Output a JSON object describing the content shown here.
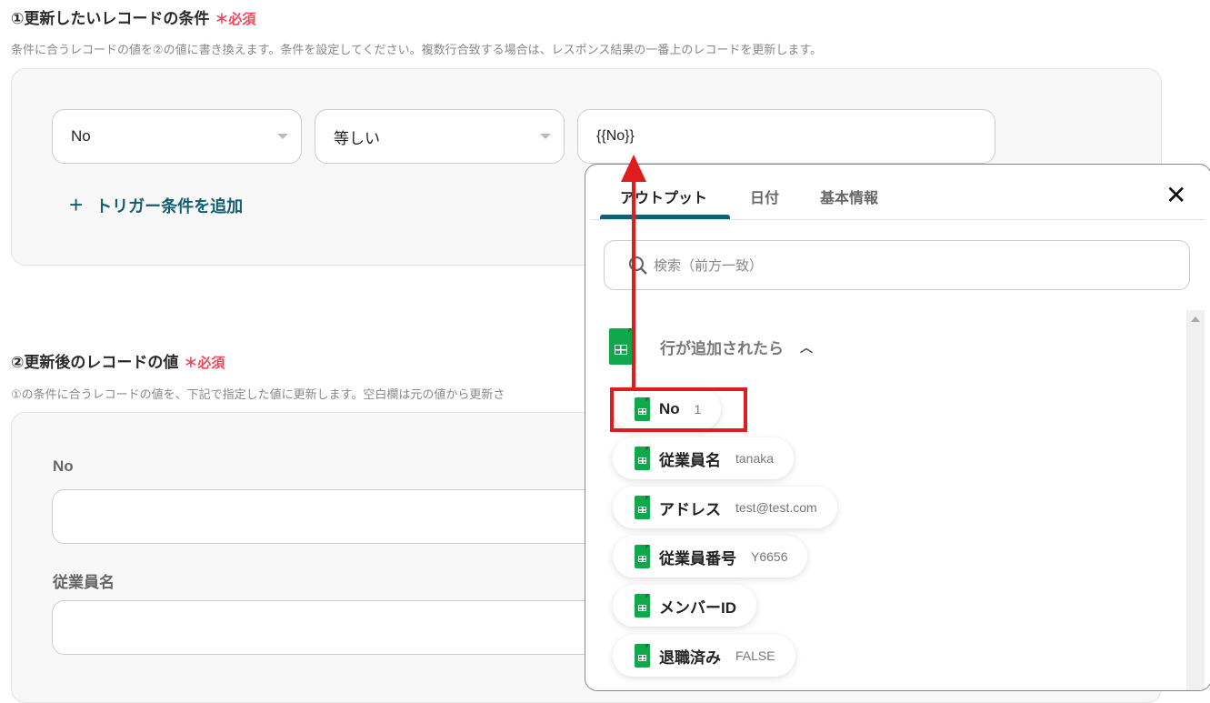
{
  "section1": {
    "title": "①更新したいレコードの条件",
    "required": "＊必須",
    "description": "条件に合うレコードの値を②の値に書き換えます。条件を設定してください。複数行合致する場合は、レスポンス結果の一番上のレコードを更新します。",
    "field_select": "No",
    "operator_select": "等しい",
    "value_input": "{{No}}",
    "add_condition": "トリガー条件を追加"
  },
  "section2": {
    "title": "②更新後のレコードの値",
    "required": "＊必須",
    "description": "①の条件に合うレコードの値を、下記で指定した値に更新します。空白欄は元の値から更新さ",
    "fields": [
      {
        "label": "No",
        "value": ""
      },
      {
        "label": "従業員名",
        "value": ""
      }
    ]
  },
  "popup": {
    "tabs": [
      "アウトプット",
      "日付",
      "基本情報"
    ],
    "active_tab": "アウトプット",
    "search_placeholder": "検索（前方一致）",
    "group_title": "行が追加されたら",
    "items": [
      {
        "key": "No",
        "value": "1"
      },
      {
        "key": "従業員名",
        "value": "tanaka"
      },
      {
        "key": "アドレス",
        "value": "test@test.com"
      },
      {
        "key": "従業員番号",
        "value": "Y6656"
      },
      {
        "key": "メンバーID",
        "value": ""
      },
      {
        "key": "退職済み",
        "value": "FALSE"
      }
    ]
  },
  "colors": {
    "accent": "#135e73",
    "required": "#f0465a",
    "highlight": "#e01c1c",
    "sheets": "#11a84c"
  }
}
